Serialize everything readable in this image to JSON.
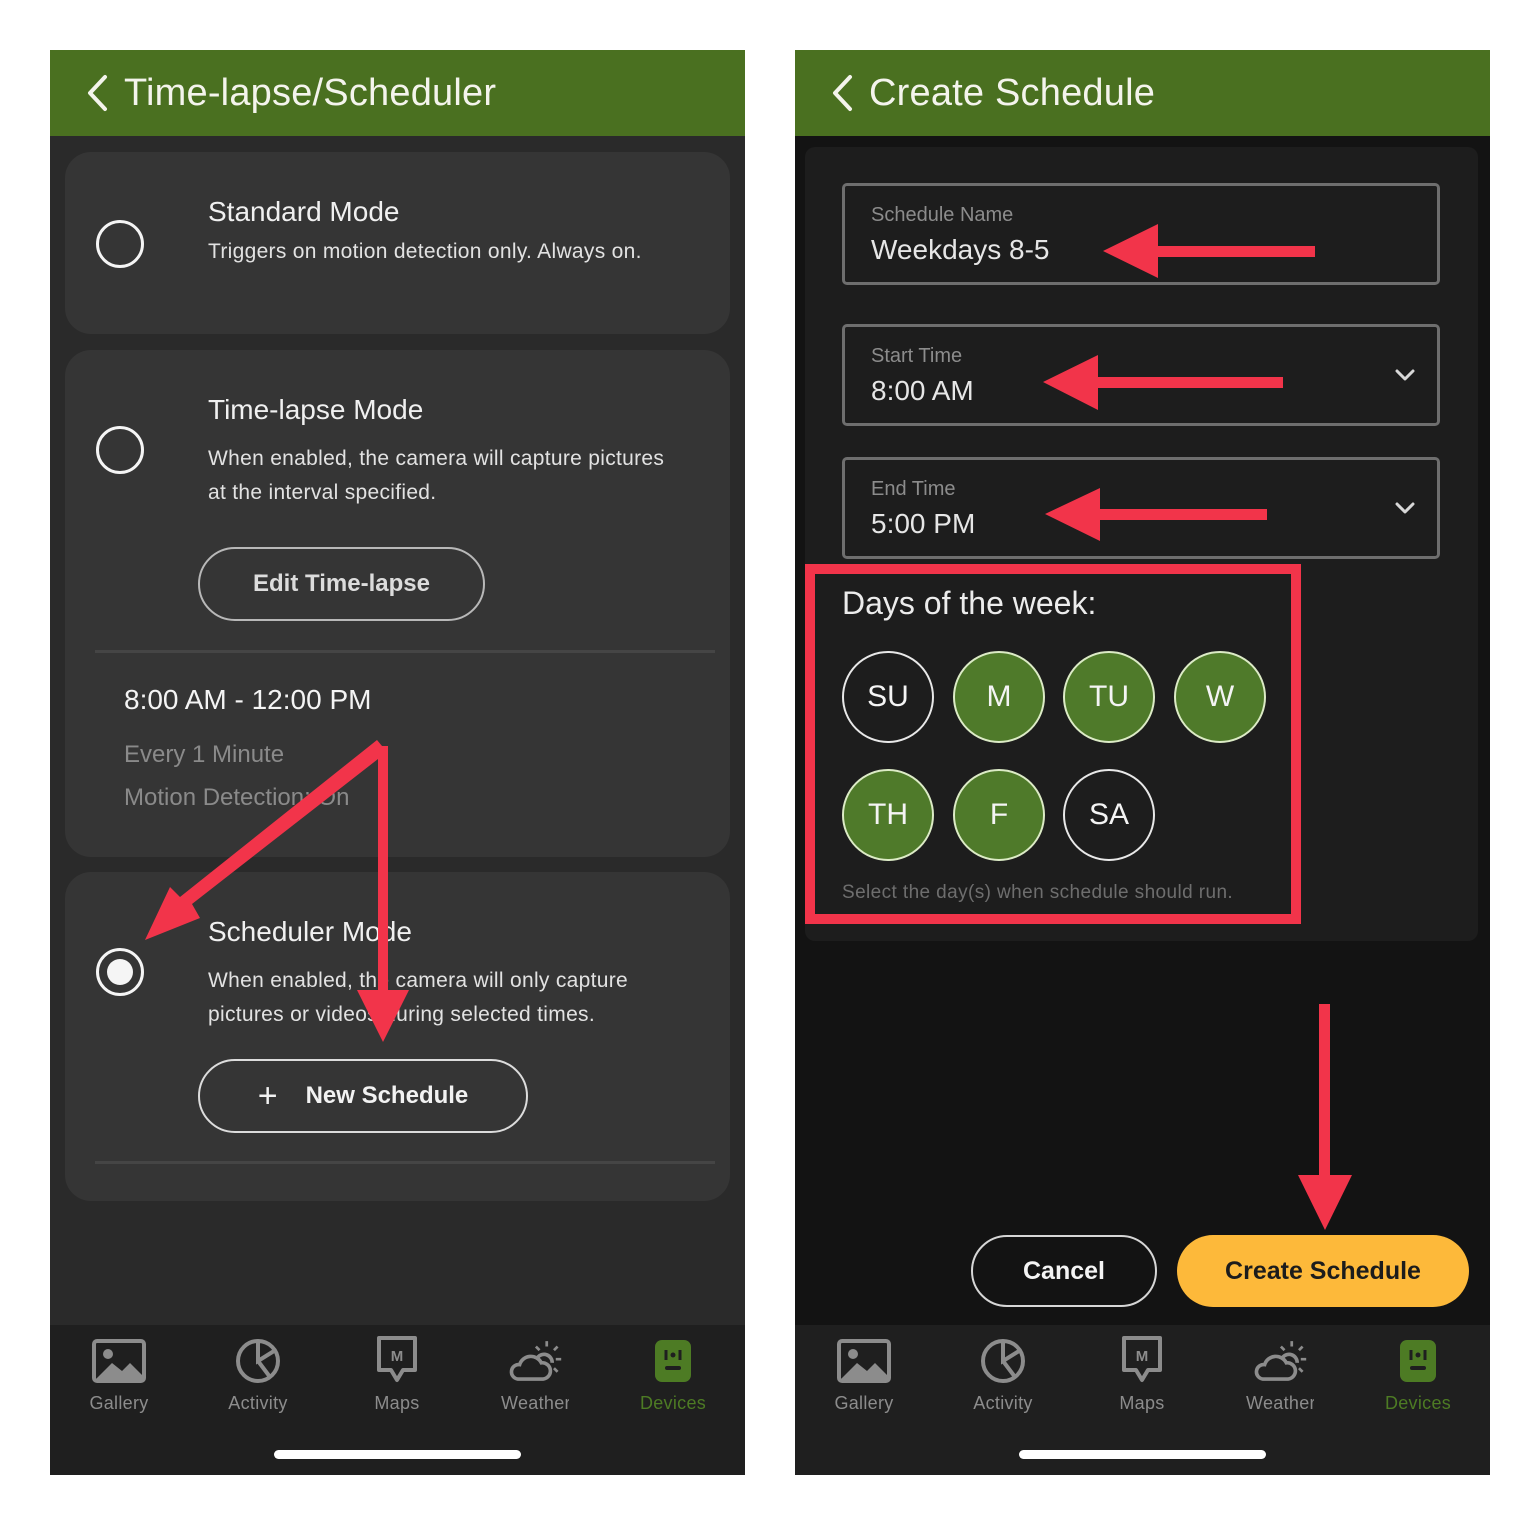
{
  "colors": {
    "header_green": "#4a7020",
    "active_green": "#4d7b24",
    "day_selected": "#4f7a2a",
    "create_button": "#fdb93a",
    "annotation_red": "#f2344a",
    "card_bg": "#353535"
  },
  "left_screen": {
    "header": {
      "title": "Time-lapse/Scheduler",
      "back_icon": "chevron-left-icon"
    },
    "modes": [
      {
        "title": "Standard Mode",
        "description": "Triggers on motion detection only. Always on.",
        "selected": false
      },
      {
        "title": "Time-lapse Mode",
        "description": "When enabled, the camera will capture pictures at the interval specified.",
        "selected": false,
        "button_label": "Edit Time-lapse",
        "schedule": {
          "range": "8:00 AM - 12:00 PM",
          "interval": "Every 1 Minute",
          "motion": "Motion Detection: On"
        }
      },
      {
        "title": "Scheduler Mode",
        "description": "When enabled, the camera will only capture pictures or videos during selected times.",
        "selected": true,
        "button_label": "New Schedule",
        "button_icon": "plus-icon"
      }
    ]
  },
  "right_screen": {
    "header": {
      "title": "Create Schedule",
      "back_icon": "chevron-left-icon"
    },
    "fields": {
      "schedule_name": {
        "label": "Schedule Name",
        "value": "Weekdays 8-5"
      },
      "start_time": {
        "label": "Start Time",
        "value": "8:00 AM"
      },
      "end_time": {
        "label": "End Time",
        "value": "5:00 PM"
      }
    },
    "days": {
      "title": "Days of the week:",
      "items": [
        {
          "label": "SU",
          "selected": false
        },
        {
          "label": "M",
          "selected": true
        },
        {
          "label": "TU",
          "selected": true
        },
        {
          "label": "W",
          "selected": true
        },
        {
          "label": "TH",
          "selected": true
        },
        {
          "label": "F",
          "selected": true
        },
        {
          "label": "SA",
          "selected": false
        }
      ],
      "hint": "Select the day(s) when schedule should run."
    },
    "buttons": {
      "cancel": "Cancel",
      "create": "Create Schedule"
    }
  },
  "bottom_nav": {
    "items": [
      {
        "label": "Gallery",
        "icon": "gallery-icon",
        "active": false
      },
      {
        "label": "Activity",
        "icon": "activity-icon",
        "active": false
      },
      {
        "label": "Maps",
        "icon": "maps-icon",
        "active": false
      },
      {
        "label": "Weather",
        "icon": "weather-icon",
        "active": false
      },
      {
        "label": "Devices",
        "icon": "devices-icon",
        "active": true
      }
    ]
  }
}
